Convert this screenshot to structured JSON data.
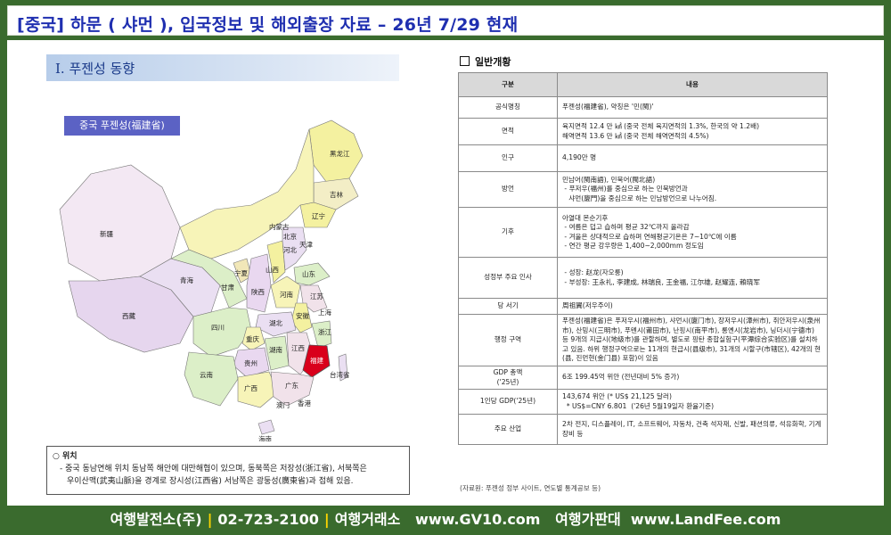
{
  "title": "[중국]  하문 ( 샤먼 ), 입국정보 및 해외출장 자료 – 26년 7/29 현재",
  "left": {
    "section_title": "Ⅰ. 푸젠성 동향",
    "map_label": "중국 푸젠성(福建省)",
    "provinces": [
      "黑龙江",
      "吉林",
      "辽宁",
      "内蒙古",
      "新疆",
      "北京",
      "天津",
      "河北",
      "山西",
      "山东",
      "宁夏",
      "甘肃",
      "青海",
      "陕西",
      "河南",
      "江苏",
      "安徽",
      "上海",
      "西藏",
      "四川",
      "湖北",
      "重庆",
      "浙江",
      "贵州",
      "湖南",
      "江西",
      "福建",
      "云南",
      "广西",
      "广东",
      "台湾省",
      "澳门",
      "香港",
      "海南"
    ],
    "location": {
      "title": "○ 위치",
      "lines": [
        "- 중국 동남연해 위치 동남쪽 해안에 대만해협이 있으며, 동북쪽은 저장성(浙江省), 서북쪽은",
        "우이산맥(武夷山脈)을 경계로 장시성(江西省) 서남쪽은 광둥성(廣東省)과 접해 있음."
      ]
    }
  },
  "right": {
    "heading": "일반개황",
    "table_header": [
      "구분",
      "내용"
    ],
    "rows": [
      {
        "k": "공식명칭",
        "v": [
          "푸젠성(福建省), 약칭은 '민(閩)'"
        ]
      },
      {
        "k": "면적",
        "v": [
          "육지면적 12.4 만 ㎢ (중국 전체 육지면적의 1.3%, 한국의 약 1.2배)",
          "해역면적 13.6 만 ㎢ (중국 전체 해역면적의 4.5%)"
        ]
      },
      {
        "k": "인구",
        "v": [
          "4,190만 명"
        ]
      },
      {
        "k": "방언",
        "v": [
          "민남어(閩南語), 민북어(閩北語)",
          " - 푸저우(福州)를 중심으로 하는 민북방언과",
          "   샤먼(廈門)을 중심으로 하는 민남방언으로 나누어짐."
        ]
      },
      {
        "k": "기후",
        "v": [
          "아열대 몬순기후",
          " - 여름은 덥고 습하며 평균 32℃까지 올라감",
          " - 겨울은 상대적으로 습하며 연해평균기온은 7~10℃에 이름",
          " - 연간 평균 강우량은 1,400~2,000mm 정도임"
        ]
      },
      {
        "k": "성정부 주요 인사",
        "v": [
          " - 성장: 赵龙(자오룽)",
          " - 부성장: 王永礼, 李建成, 林瑞良, 王金福, 江尔雄, 赵耀连, 賴晓军"
        ]
      },
      {
        "k": "당 서기",
        "v": [
          "周祖翼(저우주이)"
        ]
      },
      {
        "k": "행정 구역",
        "v": [
          "푸젠성(福建省)은 푸저우시(福州市), 샤먼시(廈门市), 장저우시(漳州市), 취안저우시(泉州市), 산밍시(三明市), 푸톈시(莆田市), 난핑시(南平市), 롱옌시(龙岩市), 닝더시(宁德市) 등 9개의 지급시(地级市)를 관할하며, 별도로 핑탄 종합실험구(平潭综合实验区)를 설치하고 있음. 하위 행정구역으로는 11개의 현급시(县级市), 31개의 시할구(市辖区), 42개의 현(县, 진먼현(金门县) 포함)이 있음"
        ]
      },
      {
        "k": "GDP 총액\n('25년)",
        "v": [
          "6조 199.45억 위안 (전년대비 5% 증가)"
        ]
      },
      {
        "k": "1인당 GDP('25년)",
        "v": [
          "143,674 위안 (* US$ 21,125 달러)",
          "  * US$=CNY 6.801  ('26년 5월19일자 환율기준)"
        ]
      },
      {
        "k": "주요 산업",
        "v": [
          "2차 전지, 디스플레이, IT, 소프트웨어, 자동차, 건축 석자재, 신발, 패션의류, 석유화학, 기계장비 등"
        ]
      }
    ],
    "source": "(자료원: 푸젠성 정부 사이트, 연도별 통계공보 등)"
  },
  "footer": {
    "part1": "여행발전소(주)",
    "part2": "02-723-2100",
    "part3": "여행거래소   www.GV10.com   여행가판대  www.LandFee.com"
  },
  "colors": {
    "green": "#3a6b2e",
    "title_blue": "#1f2fb0",
    "fujian_red": "#d9001b"
  }
}
